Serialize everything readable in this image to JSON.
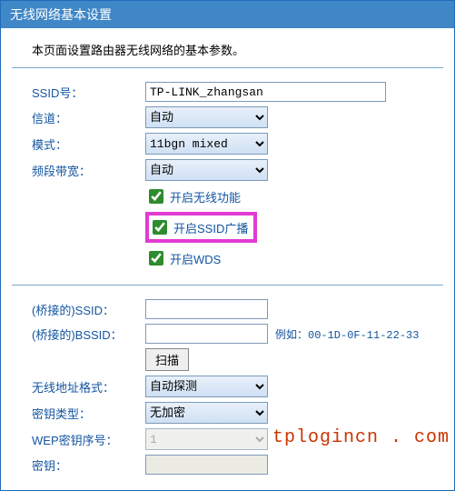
{
  "header": {
    "title": "无线网络基本设置"
  },
  "description": "本页面设置路由器无线网络的基本参数。",
  "basic": {
    "ssid_label": "SSID号：",
    "ssid_value": "TP-LINK_zhangsan",
    "channel_label": "信道：",
    "channel_value": "自动",
    "mode_label": "模式：",
    "mode_value": "11bgn mixed",
    "bandwidth_label": "频段带宽：",
    "bandwidth_value": "自动",
    "enable_wireless": "开启无线功能",
    "enable_ssid_broadcast": "开启SSID广播",
    "enable_wds": "开启WDS"
  },
  "wds": {
    "bridge_ssid_label": "(桥接的)SSID：",
    "bridge_bssid_label": "(桥接的)BSSID：",
    "bssid_example": "例如：00-1D-0F-11-22-33",
    "scan_button": "扫描",
    "addr_format_label": "无线地址格式：",
    "addr_format_value": "自动探测",
    "key_type_label": "密钥类型：",
    "key_type_value": "无加密",
    "wep_index_label": "WEP密钥序号：",
    "wep_index_value": "1",
    "key_label": "密钥："
  },
  "watermark": "tplogincn . com"
}
